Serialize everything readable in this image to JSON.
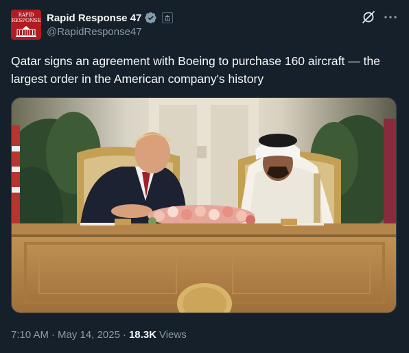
{
  "account": {
    "display_name": "Rapid Response 47",
    "handle": "@RapidResponse47",
    "avatar_text_line1": "RAPID",
    "avatar_text_line2": "RESPONSE",
    "verified_color": "#829aab",
    "avatar_color": "#b01c22"
  },
  "tweet": {
    "text": "Qatar signs an agreement with Boeing to purchase 160 aircraft — the largest order in the American company's history",
    "time": "7:10 AM",
    "separator1": "·",
    "date": "May 14, 2025",
    "separator2": "·",
    "views_count": "18.3K",
    "views_label": "Views"
  },
  "icons": {
    "grok": "grok-icon",
    "more": "more-options-icon",
    "verified": "verified-badge-icon",
    "affiliation": "government-affiliation-icon"
  },
  "theme": {
    "background": "#15202b",
    "text": "#f7f9f9",
    "secondary_text": "#8b98a5"
  }
}
